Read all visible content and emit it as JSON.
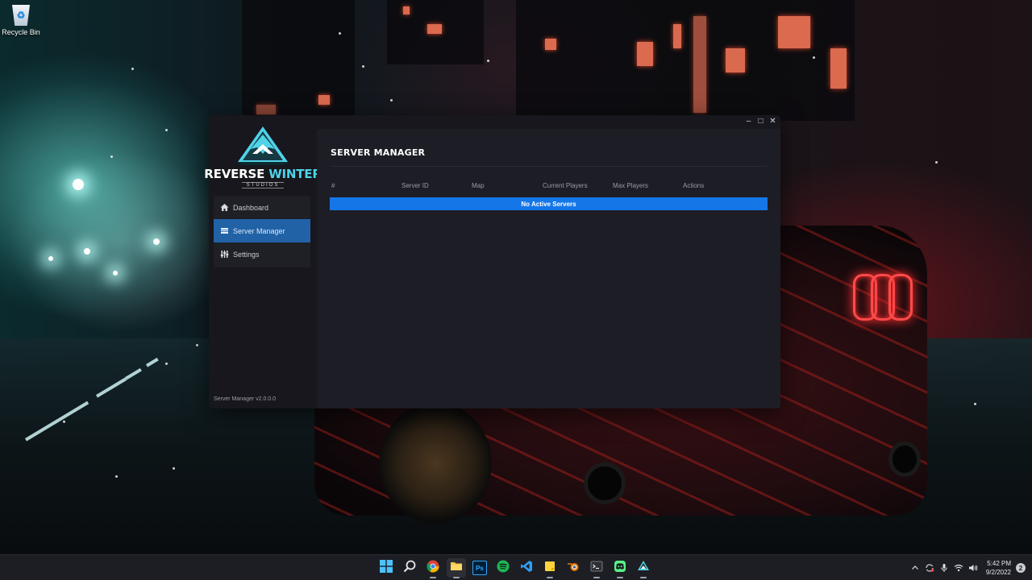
{
  "desktop": {
    "icons": [
      {
        "label": "Recycle Bin",
        "icon": "recycle-bin-icon"
      }
    ]
  },
  "window": {
    "controls": {
      "minimize": "–",
      "maximize": "□",
      "close": "✕"
    }
  },
  "sidebar": {
    "logo": {
      "word1": "REV",
      "word2": "ERSE",
      "word3": "WINTER",
      "subtitle": "STUDIOS"
    },
    "items": [
      {
        "label": "Dashboard",
        "icon": "home-icon",
        "active": false
      },
      {
        "label": "Server Manager",
        "icon": "list-icon",
        "active": true
      },
      {
        "label": "Settings",
        "icon": "sliders-icon",
        "active": false
      }
    ],
    "version": "Server Manager v2.0.0.0"
  },
  "main": {
    "title": "SERVER MANAGER",
    "table": {
      "columns": [
        "#",
        "Server ID",
        "Map",
        "Current Players",
        "Max Players",
        "Actions"
      ],
      "empty_message": "No Active Servers"
    }
  },
  "taskbar": {
    "apps": [
      {
        "name": "start",
        "icon": "windows-icon"
      },
      {
        "name": "search",
        "icon": "search-icon"
      },
      {
        "name": "chrome",
        "icon": "chrome-icon"
      },
      {
        "name": "file-explorer",
        "icon": "folder-icon"
      },
      {
        "name": "photoshop",
        "icon": "photoshop-icon",
        "glyph": "Ps"
      },
      {
        "name": "spotify",
        "icon": "spotify-icon"
      },
      {
        "name": "vscode",
        "icon": "vscode-icon"
      },
      {
        "name": "sticky-notes",
        "icon": "sticky-note-icon"
      },
      {
        "name": "blender",
        "icon": "blender-icon"
      },
      {
        "name": "terminal",
        "icon": "terminal-icon"
      },
      {
        "name": "discord",
        "icon": "discord-icon"
      },
      {
        "name": "server-manager",
        "icon": "reverse-winter-icon"
      }
    ],
    "tray": {
      "time": "5:42 PM",
      "date": "9/2/2022",
      "notifications": "2"
    }
  },
  "colors": {
    "accent_blue": "#1576e8",
    "active_nav": "#2162a6",
    "logo_cyan": "#4fd3e8",
    "window_bg": "#17171d",
    "panel_bg": "#1d1d25"
  }
}
